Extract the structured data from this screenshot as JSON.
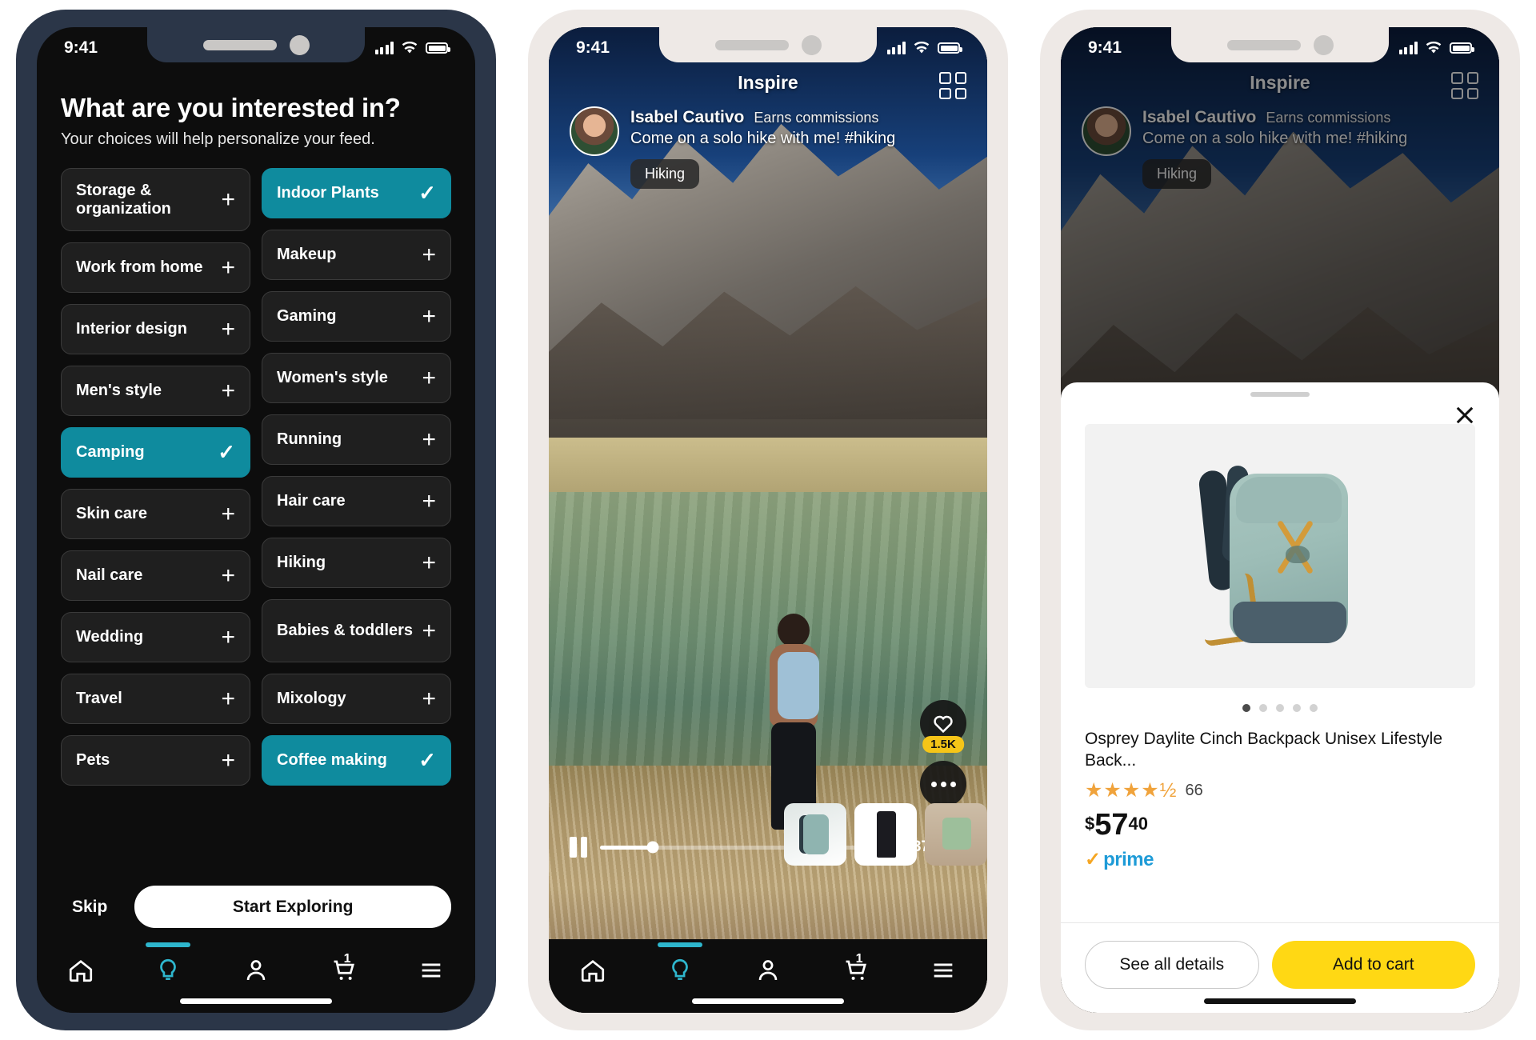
{
  "status_bar": {
    "time": "9:41"
  },
  "screen1": {
    "title": "What are you interested in?",
    "subtitle": "Your choices will help personalize your feed.",
    "accent_color": "#0f8b9e",
    "left_chips": [
      {
        "label": "Storage & organization",
        "selected": false,
        "action": "+"
      },
      {
        "label": "Work from home",
        "selected": false,
        "action": "+"
      },
      {
        "label": "Interior design",
        "selected": false,
        "action": "+"
      },
      {
        "label": "Men's style",
        "selected": false,
        "action": "+"
      },
      {
        "label": "Camping",
        "selected": true,
        "action": "✓"
      },
      {
        "label": "Skin care",
        "selected": false,
        "action": "+"
      },
      {
        "label": "Nail care",
        "selected": false,
        "action": "+"
      },
      {
        "label": "Wedding",
        "selected": false,
        "action": "+"
      },
      {
        "label": "Travel",
        "selected": false,
        "action": "+"
      },
      {
        "label": "Pets",
        "selected": false,
        "action": "+"
      }
    ],
    "right_chips": [
      {
        "label": "Indoor Plants",
        "selected": true,
        "action": "✓"
      },
      {
        "label": "Makeup",
        "selected": false,
        "action": "+"
      },
      {
        "label": "Gaming",
        "selected": false,
        "action": "+"
      },
      {
        "label": "Women's style",
        "selected": false,
        "action": "+"
      },
      {
        "label": "Running",
        "selected": false,
        "action": "+"
      },
      {
        "label": "Hair care",
        "selected": false,
        "action": "+"
      },
      {
        "label": "Hiking",
        "selected": false,
        "action": "+"
      },
      {
        "label": "Babies & toddlers",
        "selected": false,
        "action": "+"
      },
      {
        "label": "Mixology",
        "selected": false,
        "action": "+"
      },
      {
        "label": "Coffee making",
        "selected": true,
        "action": "✓"
      }
    ],
    "skip_label": "Skip",
    "cta_label": "Start Exploring"
  },
  "tabbar": {
    "items": [
      "home-icon",
      "inspire-bulb-icon",
      "account-icon",
      "cart-icon",
      "menu-icon"
    ],
    "active": "inspire-bulb-icon",
    "cart_badge": "1"
  },
  "screen2": {
    "title": "Inspire",
    "grid_icon": "grid-view-icon",
    "creator_name": "Isabel Cautivo",
    "commission_note": "Earns commissions",
    "caption": "Come on a solo hike with me! #hiking",
    "tag": "Hiking",
    "like_count": "1.5K",
    "like_icon": "heart-icon",
    "more_icon": "more-options-icon",
    "video_time": "00:37",
    "play_state": "pause-icon",
    "volume_icon": "volume-on-icon",
    "progress_percent": 19,
    "thumbnails": [
      "backpack-thumbnail",
      "pants-thumbnail",
      "top-thumbnail"
    ]
  },
  "screen3": {
    "title": "Inspire",
    "close_icon": "close-icon",
    "product_title": "Osprey Daylite Cinch Backpack Unisex Lifestyle Back...",
    "stars_display": "★★★★½",
    "rating_value": 4.5,
    "review_count": "66",
    "price_currency": "$",
    "price_whole": "57",
    "price_fraction": "40",
    "prime_label": "prime",
    "prime_check": "✓",
    "carousel_total": 5,
    "carousel_active": 1,
    "see_details_label": "See all details",
    "add_to_cart_label": "Add to cart",
    "add_to_cart_color": "#ffd814"
  }
}
